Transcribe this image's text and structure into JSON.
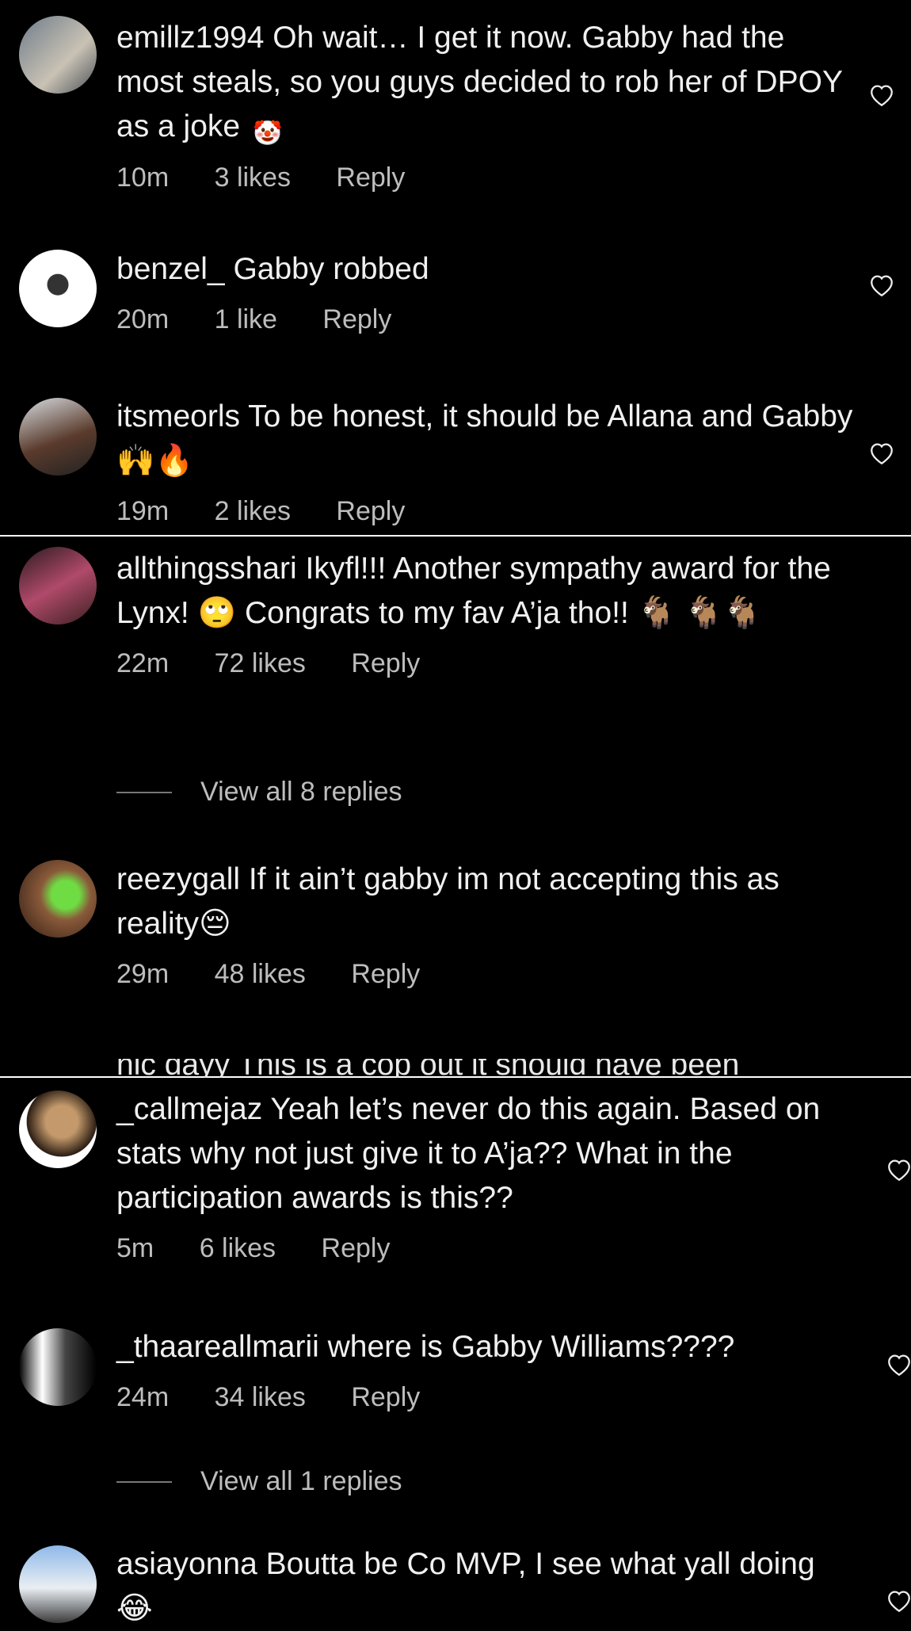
{
  "comments": [
    {
      "username": "emillz1994",
      "text": "Oh wait… I get it now. Gabby had the most steals, so you guys decided to rob her of DPOY as a joke",
      "emoji": "🤡",
      "time": "10m",
      "likes": "3 likes",
      "reply": "Reply"
    },
    {
      "username": "benzel_",
      "text": "Gabby robbed",
      "time": "20m",
      "likes": "1 like",
      "reply": "Reply"
    },
    {
      "username": "itsmeorls",
      "text": "To be honest, it should be Allana and Gabby",
      "emoji": "🙌🔥",
      "time": "19m",
      "likes": "2 likes",
      "reply": "Reply"
    },
    {
      "username": "allthingsshari",
      "text": "Ikyfl!!! Another sympathy award for the Lynx! 🙄 Congrats to my fav A’ja tho!!",
      "emoji": "🐐 🐐🐐",
      "time": "22m",
      "likes": "72 likes",
      "reply": "Reply",
      "view_replies": "View all 8 replies"
    },
    {
      "username": "reezygall",
      "text": "If it ain’t gabby im not accepting this as reality",
      "emoji": "😔",
      "time": "29m",
      "likes": "48 likes",
      "reply": "Reply"
    },
    {
      "cutoff_text": "nic dayy This is a cop out it should have been"
    },
    {
      "username": "_callmejaz",
      "text": "Yeah let’s never do this again. Based on stats why not just give it to A’ja?? What in the participation awards is this??",
      "time": "5m",
      "likes": "6 likes",
      "reply": "Reply"
    },
    {
      "username": "_thaareallmarii",
      "text": "where is Gabby Williams????",
      "time": "24m",
      "likes": "34 likes",
      "reply": "Reply",
      "view_replies": "View all 1 replies"
    },
    {
      "username": "asiayonna",
      "text": "Boutta be Co MVP, I see what yall doing",
      "emoji": "😂"
    }
  ],
  "colors": {
    "background": "#000000",
    "text": "#f0f0f0",
    "meta": "#bdbdbd"
  },
  "icons": {
    "like": "heart-outline-icon"
  }
}
